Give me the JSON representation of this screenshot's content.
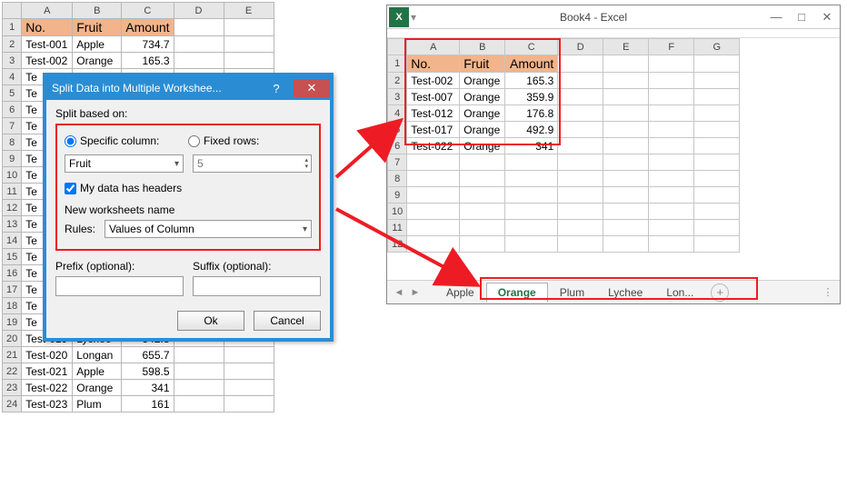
{
  "sheet1": {
    "col_letters": [
      "A",
      "B",
      "C",
      "D",
      "E"
    ],
    "headers": [
      "No.",
      "Fruit",
      "Amount"
    ],
    "rows": [
      {
        "n": 1
      },
      {
        "n": 2,
        "no": "Test-001",
        "fruit": "Apple",
        "amt": "734.7"
      },
      {
        "n": 3,
        "no": "Test-002",
        "fruit": "Orange",
        "amt": "165.3"
      },
      {
        "n": 4,
        "no": "Te"
      },
      {
        "n": 5,
        "no": "Te"
      },
      {
        "n": 6,
        "no": "Te"
      },
      {
        "n": 7,
        "no": "Te"
      },
      {
        "n": 8,
        "no": "Te"
      },
      {
        "n": 9,
        "no": "Te"
      },
      {
        "n": 10,
        "no": "Te"
      },
      {
        "n": 11,
        "no": "Te"
      },
      {
        "n": 12,
        "no": "Te"
      },
      {
        "n": 13,
        "no": "Te"
      },
      {
        "n": 14,
        "no": "Te"
      },
      {
        "n": 15,
        "no": "Te"
      },
      {
        "n": 16,
        "no": "Te"
      },
      {
        "n": 17,
        "no": "Te"
      },
      {
        "n": 18,
        "no": "Te"
      },
      {
        "n": 19,
        "no": "Te"
      },
      {
        "n": 20,
        "no": "Test-019",
        "fruit": "Lychee",
        "amt": "542.8"
      },
      {
        "n": 21,
        "no": "Test-020",
        "fruit": "Longan",
        "amt": "655.7"
      },
      {
        "n": 22,
        "no": "Test-021",
        "fruit": "Apple",
        "amt": "598.5"
      },
      {
        "n": 23,
        "no": "Test-022",
        "fruit": "Orange",
        "amt": "341"
      },
      {
        "n": 24,
        "no": "Test-023",
        "fruit": "Plum",
        "amt": "161"
      }
    ]
  },
  "dialog": {
    "title": "Split Data into Multiple Workshee...",
    "split_based_on": "Split based on:",
    "opt_specific": "Specific column:",
    "opt_fixed": "Fixed rows:",
    "col_value": "Fruit",
    "rows_value": "5",
    "has_headers": "My data has headers",
    "new_ws_name": "New worksheets name",
    "rules_label": "Rules:",
    "rules_value": "Values of Column",
    "prefix_label": "Prefix (optional):",
    "suffix_label": "Suffix (optional):",
    "ok": "Ok",
    "cancel": "Cancel"
  },
  "win": {
    "doc": "Book4 - Excel",
    "sheet": {
      "col_letters": [
        "A",
        "B",
        "C",
        "D",
        "E",
        "F",
        "G"
      ],
      "headers": [
        "No.",
        "Fruit",
        "Amount"
      ],
      "rows": [
        {
          "n": 1
        },
        {
          "n": 2,
          "no": "Test-002",
          "fruit": "Orange",
          "amt": "165.3"
        },
        {
          "n": 3,
          "no": "Test-007",
          "fruit": "Orange",
          "amt": "359.9"
        },
        {
          "n": 4,
          "no": "Test-012",
          "fruit": "Orange",
          "amt": "176.8"
        },
        {
          "n": 5,
          "no": "Test-017",
          "fruit": "Orange",
          "amt": "492.9"
        },
        {
          "n": 6,
          "no": "Test-022",
          "fruit": "Orange",
          "amt": "341"
        },
        {
          "n": 7
        },
        {
          "n": 8
        },
        {
          "n": 9
        },
        {
          "n": 10
        },
        {
          "n": 11
        },
        {
          "n": 12
        }
      ]
    },
    "tabs": [
      "Apple",
      "Orange",
      "Plum",
      "Lychee",
      "Lon..."
    ],
    "active_tab": 1
  }
}
